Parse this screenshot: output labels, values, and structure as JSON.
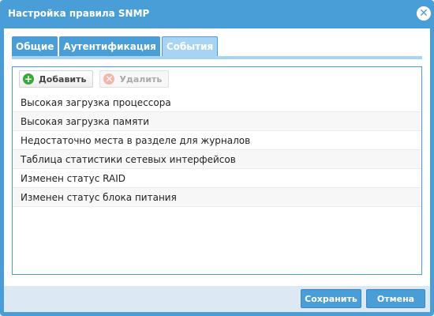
{
  "window": {
    "title": "Настройка правила SNMP",
    "close_icon": "close-icon"
  },
  "tabs": [
    {
      "label": "Общие",
      "active": false
    },
    {
      "label": "Аутентификация",
      "active": false
    },
    {
      "label": "События",
      "active": true
    }
  ],
  "toolbar": {
    "add_label": "Добавить",
    "add_icon": "plus-circle-icon",
    "delete_label": "Удалить",
    "delete_icon": "x-circle-icon",
    "delete_enabled": false
  },
  "events": [
    "Высокая загрузка процессора",
    "Высокая загрузка памяти",
    "Недостаточно места в разделе для журналов",
    "Таблица статистики сетевых интерфейсов",
    "Изменен статус RAID",
    "Изменен статус блока питания"
  ],
  "footer": {
    "save_label": "Сохранить",
    "cancel_label": "Отмена"
  },
  "colors": {
    "accent": "#4a9ed8",
    "footer_bg": "#dce9f5",
    "active_tab": "#a8d4f4"
  }
}
